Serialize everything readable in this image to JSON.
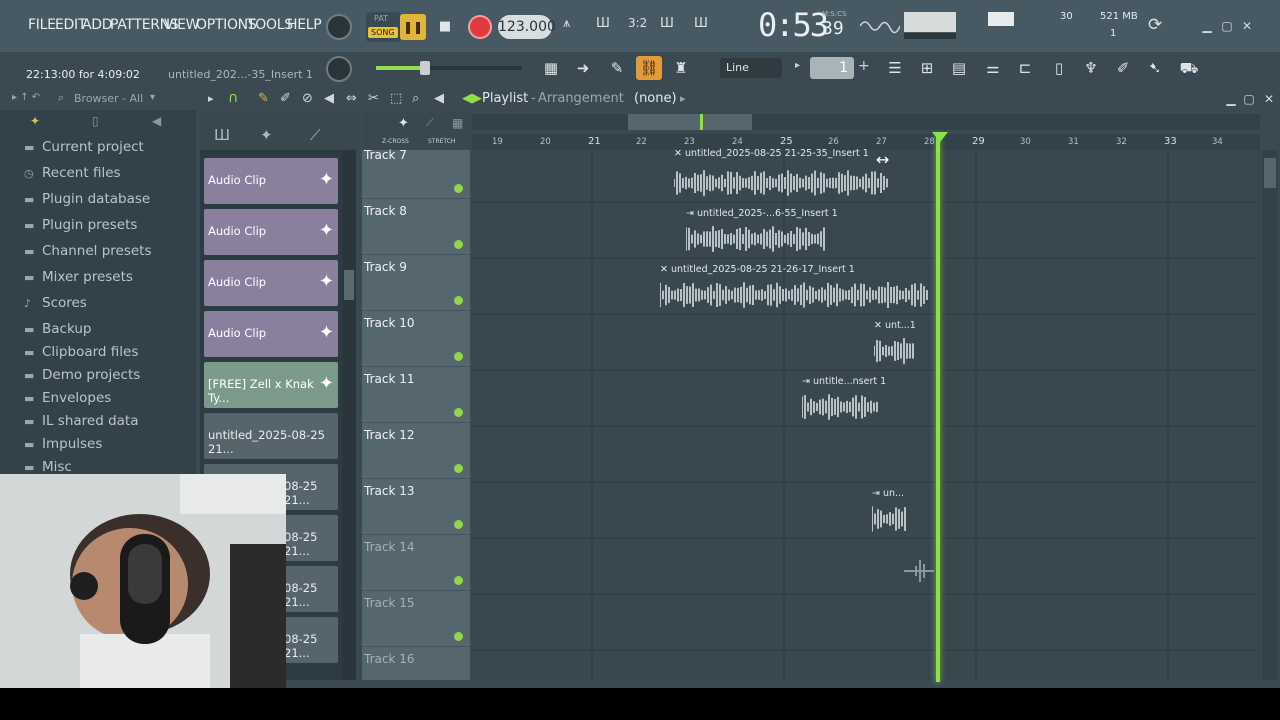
{
  "menu": [
    "FILE",
    "EDIT",
    "ADD",
    "PATTERNS",
    "VIEW",
    "OPTIONS",
    "TOOLS",
    "HELP"
  ],
  "transport": {
    "pat_label": "PAT",
    "song_label": "SONG",
    "tempo": "123.000",
    "time": "0:53",
    "time_sub": "39",
    "time_unit": "M:S:CS"
  },
  "stats": {
    "cpu": "30",
    "ram": "521 MB",
    "voices": "1"
  },
  "hint": {
    "time": "22:13:00 for 4:09:02",
    "file": "untitled_202...-35_Insert 1"
  },
  "snap": {
    "mode": "Line",
    "step": "1"
  },
  "browser": {
    "header": "Browser - All",
    "items": [
      {
        "icon": "folder-icon",
        "glyph": "▬",
        "label": "Current project"
      },
      {
        "icon": "clock-icon",
        "glyph": "◷",
        "label": "Recent files"
      },
      {
        "icon": "database-icon",
        "glyph": "▬",
        "label": "Plugin database"
      },
      {
        "icon": "folder-icon",
        "glyph": "▬",
        "label": "Plugin presets"
      },
      {
        "icon": "folder-icon",
        "glyph": "▬",
        "label": "Channel presets"
      },
      {
        "icon": "folder-icon",
        "glyph": "▬",
        "label": "Mixer presets"
      },
      {
        "icon": "note-icon",
        "glyph": "♪",
        "label": "Scores"
      },
      {
        "icon": "folder-icon",
        "glyph": "▬",
        "label": "Backup"
      },
      {
        "icon": "folder-icon",
        "glyph": "▬",
        "label": "Clipboard files"
      },
      {
        "icon": "folder-icon",
        "glyph": "▬",
        "label": "Demo projects"
      },
      {
        "icon": "folder-icon",
        "glyph": "▬",
        "label": "Envelopes"
      },
      {
        "icon": "folder-icon",
        "glyph": "▬",
        "label": "IL shared data"
      },
      {
        "icon": "folder-icon",
        "glyph": "▬",
        "label": "Impulses"
      },
      {
        "icon": "folder-icon",
        "glyph": "▬",
        "label": "Misc"
      }
    ]
  },
  "playlist": {
    "title": "Playlist",
    "subtitle": "Arrangement",
    "pattern": "(none)",
    "crossfade": "Z-CROSS",
    "stretch": "STRETCH"
  },
  "clips": [
    "Audio Clip",
    "Audio Clip",
    "Audio Clip",
    "Audio Clip",
    "[FREE] Zell x Knak Ty...",
    "untitled_2025-08-25 21...",
    "08-25 21...",
    "08-25 21...",
    "08-25 21...",
    "08-25 21..."
  ],
  "tracks": [
    "Track 7",
    "Track 8",
    "Track 9",
    "Track 10",
    "Track 11",
    "Track 12",
    "Track 13",
    "Track 14",
    "Track 15",
    "Track 16"
  ],
  "ruler": [
    "19",
    "20",
    "21",
    "22",
    "23",
    "24",
    "25",
    "26",
    "27",
    "28",
    "29",
    "30",
    "31",
    "32",
    "33",
    "34"
  ],
  "arrangement_clips": [
    {
      "label": "✕ untitled_2025-08-25 21-25-35_Insert 1",
      "track": 0
    },
    {
      "label": "⇥ untitled_2025-...6-55_Insert 1",
      "track": 1
    },
    {
      "label": "✕ untitled_2025-08-25 21-26-17_Insert 1",
      "track": 2
    },
    {
      "label": "✕ unt...1",
      "track": 3
    },
    {
      "label": "⇥ untitle...nsert 1",
      "track": 4
    },
    {
      "label": "⇥ un...",
      "track": 6
    }
  ],
  "colors": {
    "accent": "#8ee04a",
    "record": "#e0393e",
    "clip": "#8b7f9e"
  }
}
